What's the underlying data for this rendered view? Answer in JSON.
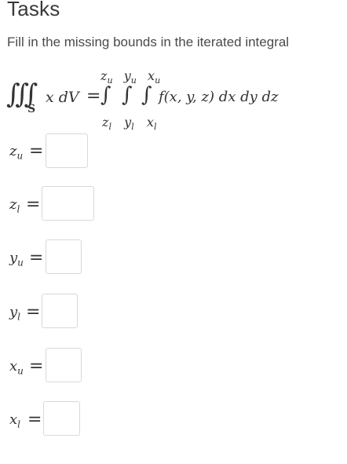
{
  "header": {
    "title": "Tasks"
  },
  "instruction": "Fill in the missing bounds in the iterated integral",
  "integral": {
    "lhs_symbol": "∭",
    "region": "S",
    "integrand": "x dV",
    "equals": "=",
    "upper_bounds": [
      "z_u",
      "y_u",
      "x_u"
    ],
    "lower_bounds": [
      "z_l",
      "y_l",
      "x_l"
    ],
    "integral_sign": "∫",
    "rhs_integrand": "f(x, y, z) dx dy dz"
  },
  "fields": [
    {
      "var": "z",
      "sub": "u",
      "equals": "=",
      "value": ""
    },
    {
      "var": "z",
      "sub": "l",
      "equals": "=",
      "value": ""
    },
    {
      "var": "y",
      "sub": "u",
      "equals": "=",
      "value": ""
    },
    {
      "var": "y",
      "sub": "l",
      "equals": "=",
      "value": ""
    },
    {
      "var": "x",
      "sub": "u",
      "equals": "=",
      "value": ""
    },
    {
      "var": "x",
      "sub": "l",
      "equals": "=",
      "value": ""
    }
  ]
}
